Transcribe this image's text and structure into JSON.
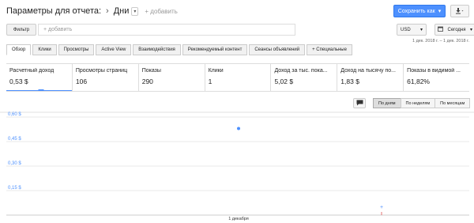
{
  "header": {
    "title": "Параметры для отчета:",
    "separator": "›",
    "dimension": "Дни",
    "add_label": "+ добавить",
    "save_label": "Сохранить как",
    "save_caret": "▾",
    "download_icon": "download-icon"
  },
  "filter": {
    "button_label": "Фильтр",
    "placeholder": "+ добавить",
    "currency": "USD",
    "date_label": "Сегодня",
    "date_range": "1 дек. 2018 г. – 1 дек. 2018 г."
  },
  "tabs": [
    {
      "label": "Обзор"
    },
    {
      "label": "Клики"
    },
    {
      "label": "Просмотры"
    },
    {
      "label": "Active View"
    },
    {
      "label": "Взаимодействия"
    },
    {
      "label": "Рекомендуемый контент"
    },
    {
      "label": "Сеансы объявлений"
    },
    {
      "label": "+  Специальные"
    }
  ],
  "metrics": [
    {
      "label": "Расчетный доход",
      "value": "0,53 $"
    },
    {
      "label": "Просмотры страниц",
      "value": "106"
    },
    {
      "label": "Показы",
      "value": "290"
    },
    {
      "label": "Клики",
      "value": "1"
    },
    {
      "label": "Доход за тыс. пока...",
      "value": "5,02 $"
    },
    {
      "label": "Доход на тысячу по...",
      "value": "1,83 $"
    },
    {
      "label": "Показы в видимой ...",
      "value": "61,82%"
    }
  ],
  "granularity": {
    "by_day": "По дням",
    "by_week": "По неделям",
    "by_month": "По месяцам"
  },
  "chart_data": {
    "type": "scatter",
    "y_ticks": [
      "0,60 $",
      "0,45 $",
      "0,30 $",
      "0,15 $"
    ],
    "y_tick_values": [
      0.6,
      0.45,
      0.3,
      0.15
    ],
    "ylim": [
      0,
      0.6
    ],
    "x_label": "1 декабря",
    "series": [
      {
        "x": [
          "1 декабря"
        ],
        "values": [
          0.53
        ],
        "color": "#4d90fe"
      }
    ],
    "annotation_marker": "+"
  },
  "colors": {
    "accent": "#4d90fe",
    "grid": "#e8e8e8",
    "tick_text": "#4d90fe"
  }
}
